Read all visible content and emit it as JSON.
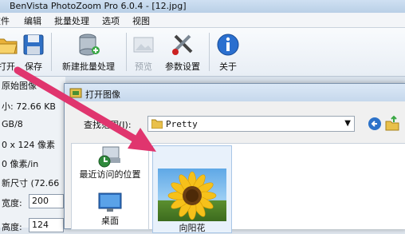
{
  "window": {
    "title": "BenVista PhotoZoom Pro 6.0.4 - [12.jpg]"
  },
  "menu": [
    "文件",
    "编辑",
    "批量处理",
    "选项",
    "视图"
  ],
  "toolbar": {
    "open": "打开",
    "save": "保存",
    "batch": "新建批量处理",
    "preview": "预览",
    "settings": "参数设置",
    "about": "关于"
  },
  "info_panel": {
    "header": "原始图像",
    "size": "小: 72.66 KB",
    "mode": "GB/8",
    "dims": "0 x 124 像素",
    "res": "0 像素/in",
    "new_size": "新尺寸 (72.66",
    "width_label": "宽度:",
    "width_value": "200",
    "height_label": "高度:",
    "height_value": "124"
  },
  "dialog": {
    "title": "打开图像",
    "look_in_label": "查找范围(I):",
    "look_in_value": "Pretty",
    "places": {
      "recent": "最近访问的位置",
      "desktop": "桌面"
    },
    "file": {
      "name": "向阳花"
    }
  },
  "colors": {
    "arrow": "#e0356e",
    "accent": "#2a6fcf"
  }
}
